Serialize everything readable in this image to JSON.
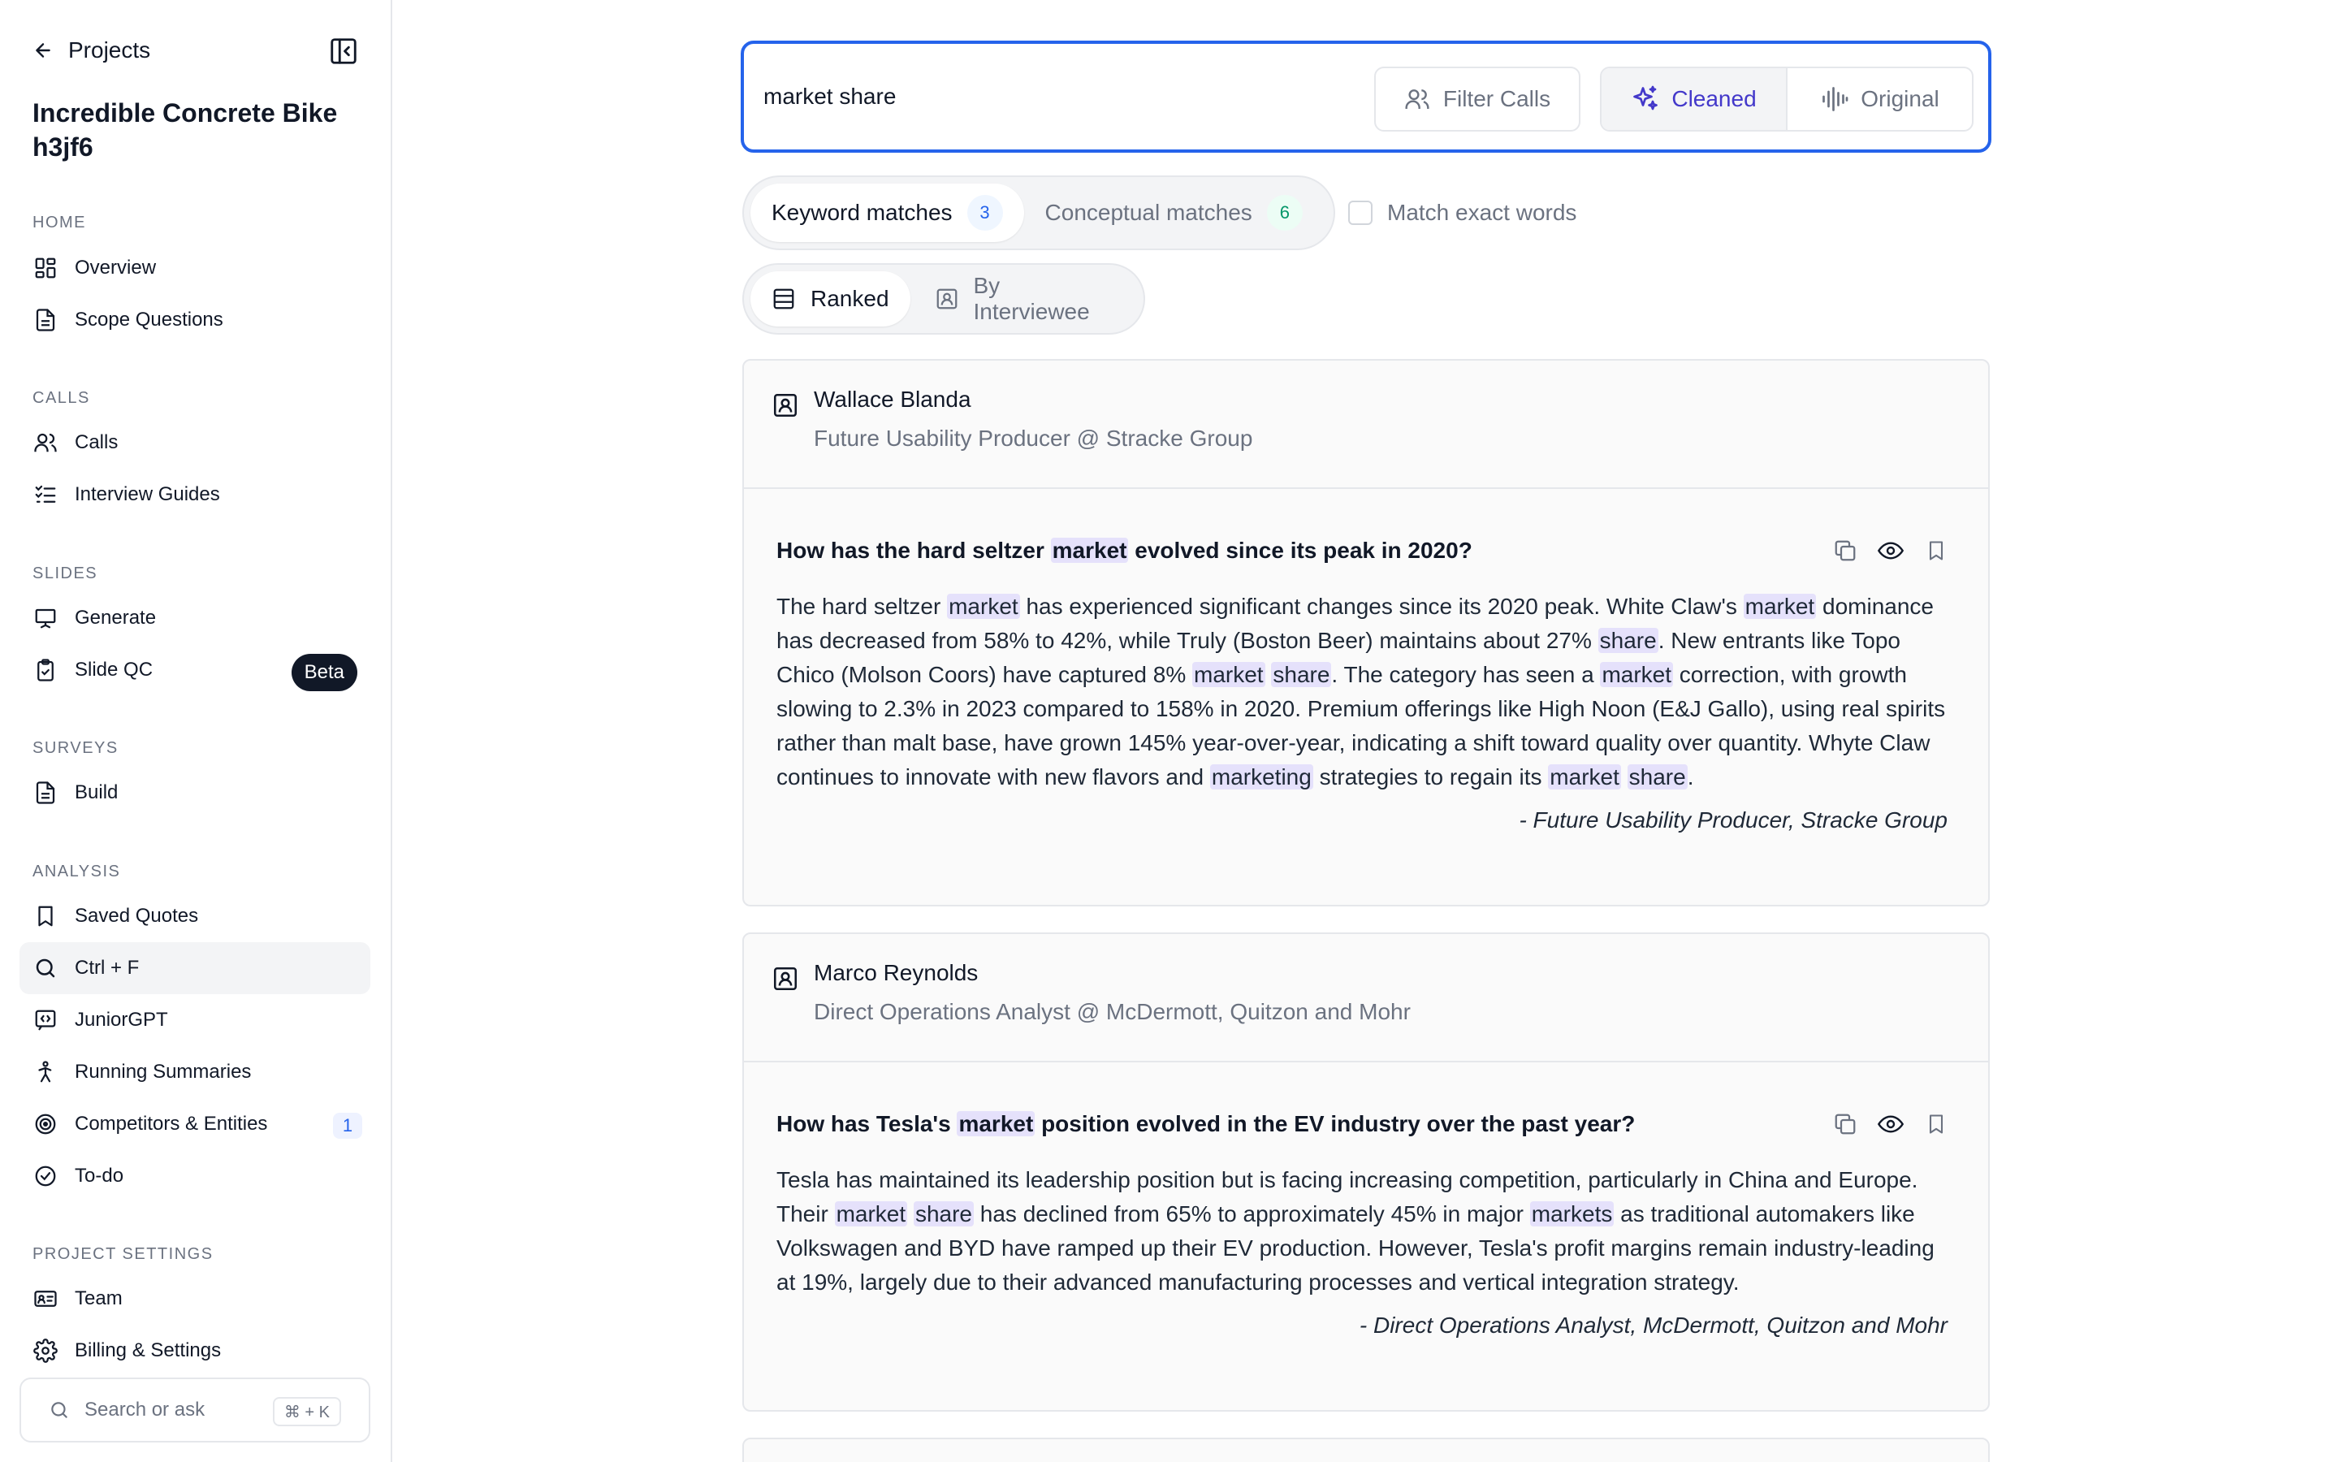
{
  "sidebar": {
    "back_label": "Projects",
    "project_title": "Incredible Concrete Bike h3jf6",
    "sections": {
      "home": "HOME",
      "calls": "CALLS",
      "slides": "SLIDES",
      "surveys": "SURVEYS",
      "analysis": "ANALYSIS",
      "project_settings": "PROJECT SETTINGS"
    },
    "items": {
      "overview": "Overview",
      "scope_questions": "Scope Questions",
      "calls": "Calls",
      "interview_guides": "Interview Guides",
      "generate": "Generate",
      "slide_qc": "Slide QC",
      "slide_qc_badge": "Beta",
      "build": "Build",
      "saved_quotes": "Saved Quotes",
      "ctrl_f": "Ctrl + F",
      "junior_gpt": "JuniorGPT",
      "running_summaries": "Running Summaries",
      "competitors": "Competitors & Entities",
      "competitors_count": "1",
      "todo": "To-do",
      "team": "Team",
      "billing": "Billing & Settings"
    },
    "search_placeholder": "Search or ask",
    "search_shortcut": "⌘ + K",
    "active_item": "ctrl_f"
  },
  "search": {
    "value": "market share",
    "filter_label": "Filter Calls",
    "mode_cleaned": "Cleaned",
    "mode_original": "Original",
    "active_mode": "Cleaned"
  },
  "match_tabs": {
    "keyword_label": "Keyword matches",
    "keyword_count": "3",
    "conceptual_label": "Conceptual matches",
    "conceptual_count": "6",
    "exact_label": "Match exact words",
    "exact_checked": false
  },
  "view_tabs": {
    "ranked": "Ranked",
    "by_interviewee": "By Interviewee"
  },
  "results": [
    {
      "name": "Wallace Blanda",
      "role": "Future Usability Producer @ Stracke Group",
      "question": [
        {
          "t": "How has the hard seltzer "
        },
        {
          "t": "market",
          "h": true
        },
        {
          "t": " evolved since its peak in 2020?"
        }
      ],
      "answer": [
        {
          "t": "The hard seltzer "
        },
        {
          "t": "market",
          "h": true
        },
        {
          "t": " has experienced significant changes since its 2020 peak. White Claw's "
        },
        {
          "t": "market",
          "h": true
        },
        {
          "t": " dominance has decreased from 58% to 42%, while Truly (Boston Beer) maintains about 27% "
        },
        {
          "t": "share",
          "h": true
        },
        {
          "t": ". New entrants like Topo Chico (Molson Coors) have captured 8% "
        },
        {
          "t": "market",
          "h": true
        },
        {
          "t": " "
        },
        {
          "t": "share",
          "h": true
        },
        {
          "t": ". The category has seen a "
        },
        {
          "t": "market",
          "h": true
        },
        {
          "t": " correction, with growth slowing to 2.3% in 2023 compared to 158% in 2020. Premium offerings like High Noon (E&J Gallo), using real spirits rather than malt base, have grown 145% year-over-year, indicating a shift toward quality over quantity. Whyte Claw continues to innovate with new flavors and "
        },
        {
          "t": "marketing",
          "h": true
        },
        {
          "t": " strategies to regain its "
        },
        {
          "t": "market",
          "h": true
        },
        {
          "t": " "
        },
        {
          "t": "share",
          "h": true
        },
        {
          "t": "."
        }
      ],
      "attribution": "- Future Usability Producer, Stracke Group"
    },
    {
      "name": "Marco Reynolds",
      "role": "Direct Operations Analyst @ McDermott, Quitzon and Mohr",
      "question": [
        {
          "t": "How has Tesla's "
        },
        {
          "t": "market",
          "h": true
        },
        {
          "t": " position evolved in the EV industry over the past year?"
        }
      ],
      "answer": [
        {
          "t": "Tesla has maintained its leadership position but is facing increasing competition, particularly in China and Europe. Their "
        },
        {
          "t": "market",
          "h": true
        },
        {
          "t": " "
        },
        {
          "t": "share",
          "h": true
        },
        {
          "t": " has declined from 65% to approximately 45% in major "
        },
        {
          "t": "markets",
          "h": true
        },
        {
          "t": " as traditional automakers like Volkswagen and BYD have ramped up their EV production. However, Tesla's profit margins remain industry-leading at 19%, largely due to their advanced manufacturing processes and vertical integration strategy."
        }
      ],
      "attribution": "- Direct Operations Analyst, McDermott, Quitzon and Mohr"
    }
  ],
  "colors": {
    "accent": "#2563eb",
    "highlight": "#e5e1fb",
    "cleaned_text": "#4338ca"
  }
}
